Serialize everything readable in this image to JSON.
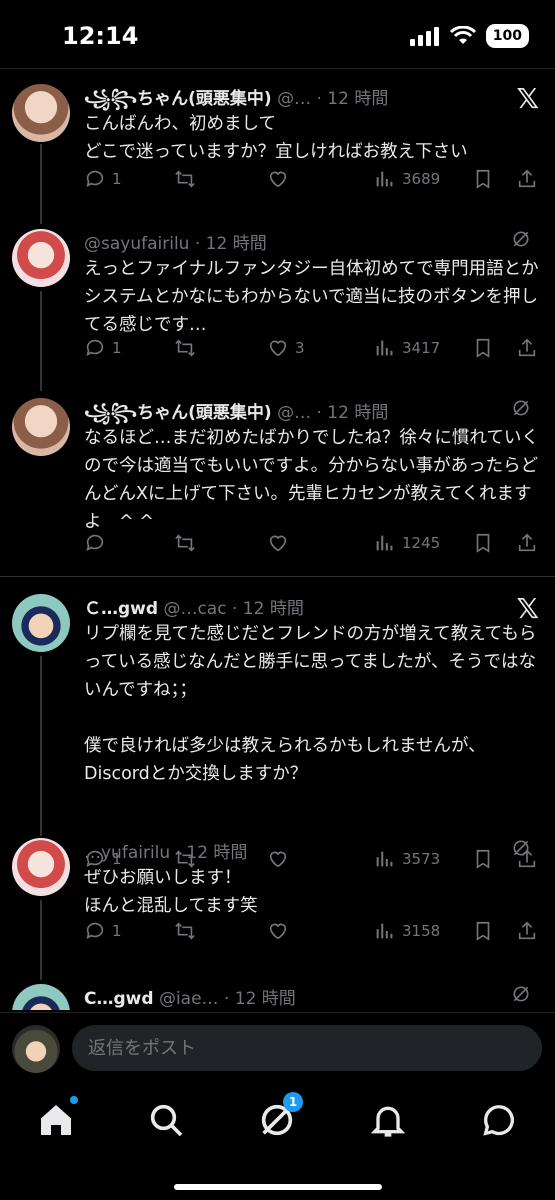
{
  "status_bar": {
    "time": "12:14",
    "battery": "100"
  },
  "tweets": [
    {
      "name": "꧁꧂ちゃん(頭悪集中)",
      "handle": "@…",
      "time": "12 時間",
      "text": "こんばんわ、初めまして\nどこで迷っていますか？宜しければお教え下さい",
      "replies": "1",
      "retweets": "",
      "likes": "",
      "views": "3689"
    },
    {
      "name": "",
      "handle": "@sayufairilu",
      "time": "12 時間",
      "text": "えっとファイナルファンタジー自体初めてで専門用語とかシステムとかなにもわからないで適当に技のボタンを押してる感じです…",
      "replies": "1",
      "retweets": "",
      "likes": "3",
      "views": "3417"
    },
    {
      "name": "꧁꧂ちゃん(頭悪集中)",
      "handle": "@…",
      "time": "12 時間",
      "text": "なるほど…まだ初めたばかりでしたね？徐々に慣れていくので今は適当でもいいですよ。分からない事があったらどんどんXに上げて下さい。先輩ヒカセンが教えてくれますよ　^ ^",
      "replies": "",
      "retweets": "",
      "likes": "",
      "views": "1245"
    },
    {
      "name": "Ｃ…gwd",
      "handle": "@…cac",
      "time": "12 時間",
      "text": "リプ欄を見てた感じだとフレンドの方が増えて教えてもらっている感じなんだと勝手に思ってましたが、そうではないんですね；；\n\n僕で良ければ多少は教えられるかもしれませんが、Discordとか交換しますか？",
      "replies": "1",
      "retweets": "",
      "likes": "",
      "views": "3573"
    },
    {
      "name": "",
      "handle": "…yufairilu",
      "time": "12 時間",
      "text": "ぜひお願いします！\nほんと混乱してます笑",
      "replies": "1",
      "retweets": "",
      "likes": "",
      "views": "3158"
    },
    {
      "name": "C…gwd",
      "handle": "@iae…",
      "time": "12 時間",
      "text": "",
      "replies": "",
      "retweets": "",
      "likes": "",
      "views": ""
    }
  ],
  "reply": {
    "placeholder": "返信をポスト"
  },
  "tabs": {
    "messages_badge": "1"
  },
  "colors": {
    "accent": "#1d9bf0",
    "muted": "#71767b",
    "text": "#e7e9ea",
    "background": "#000000"
  }
}
